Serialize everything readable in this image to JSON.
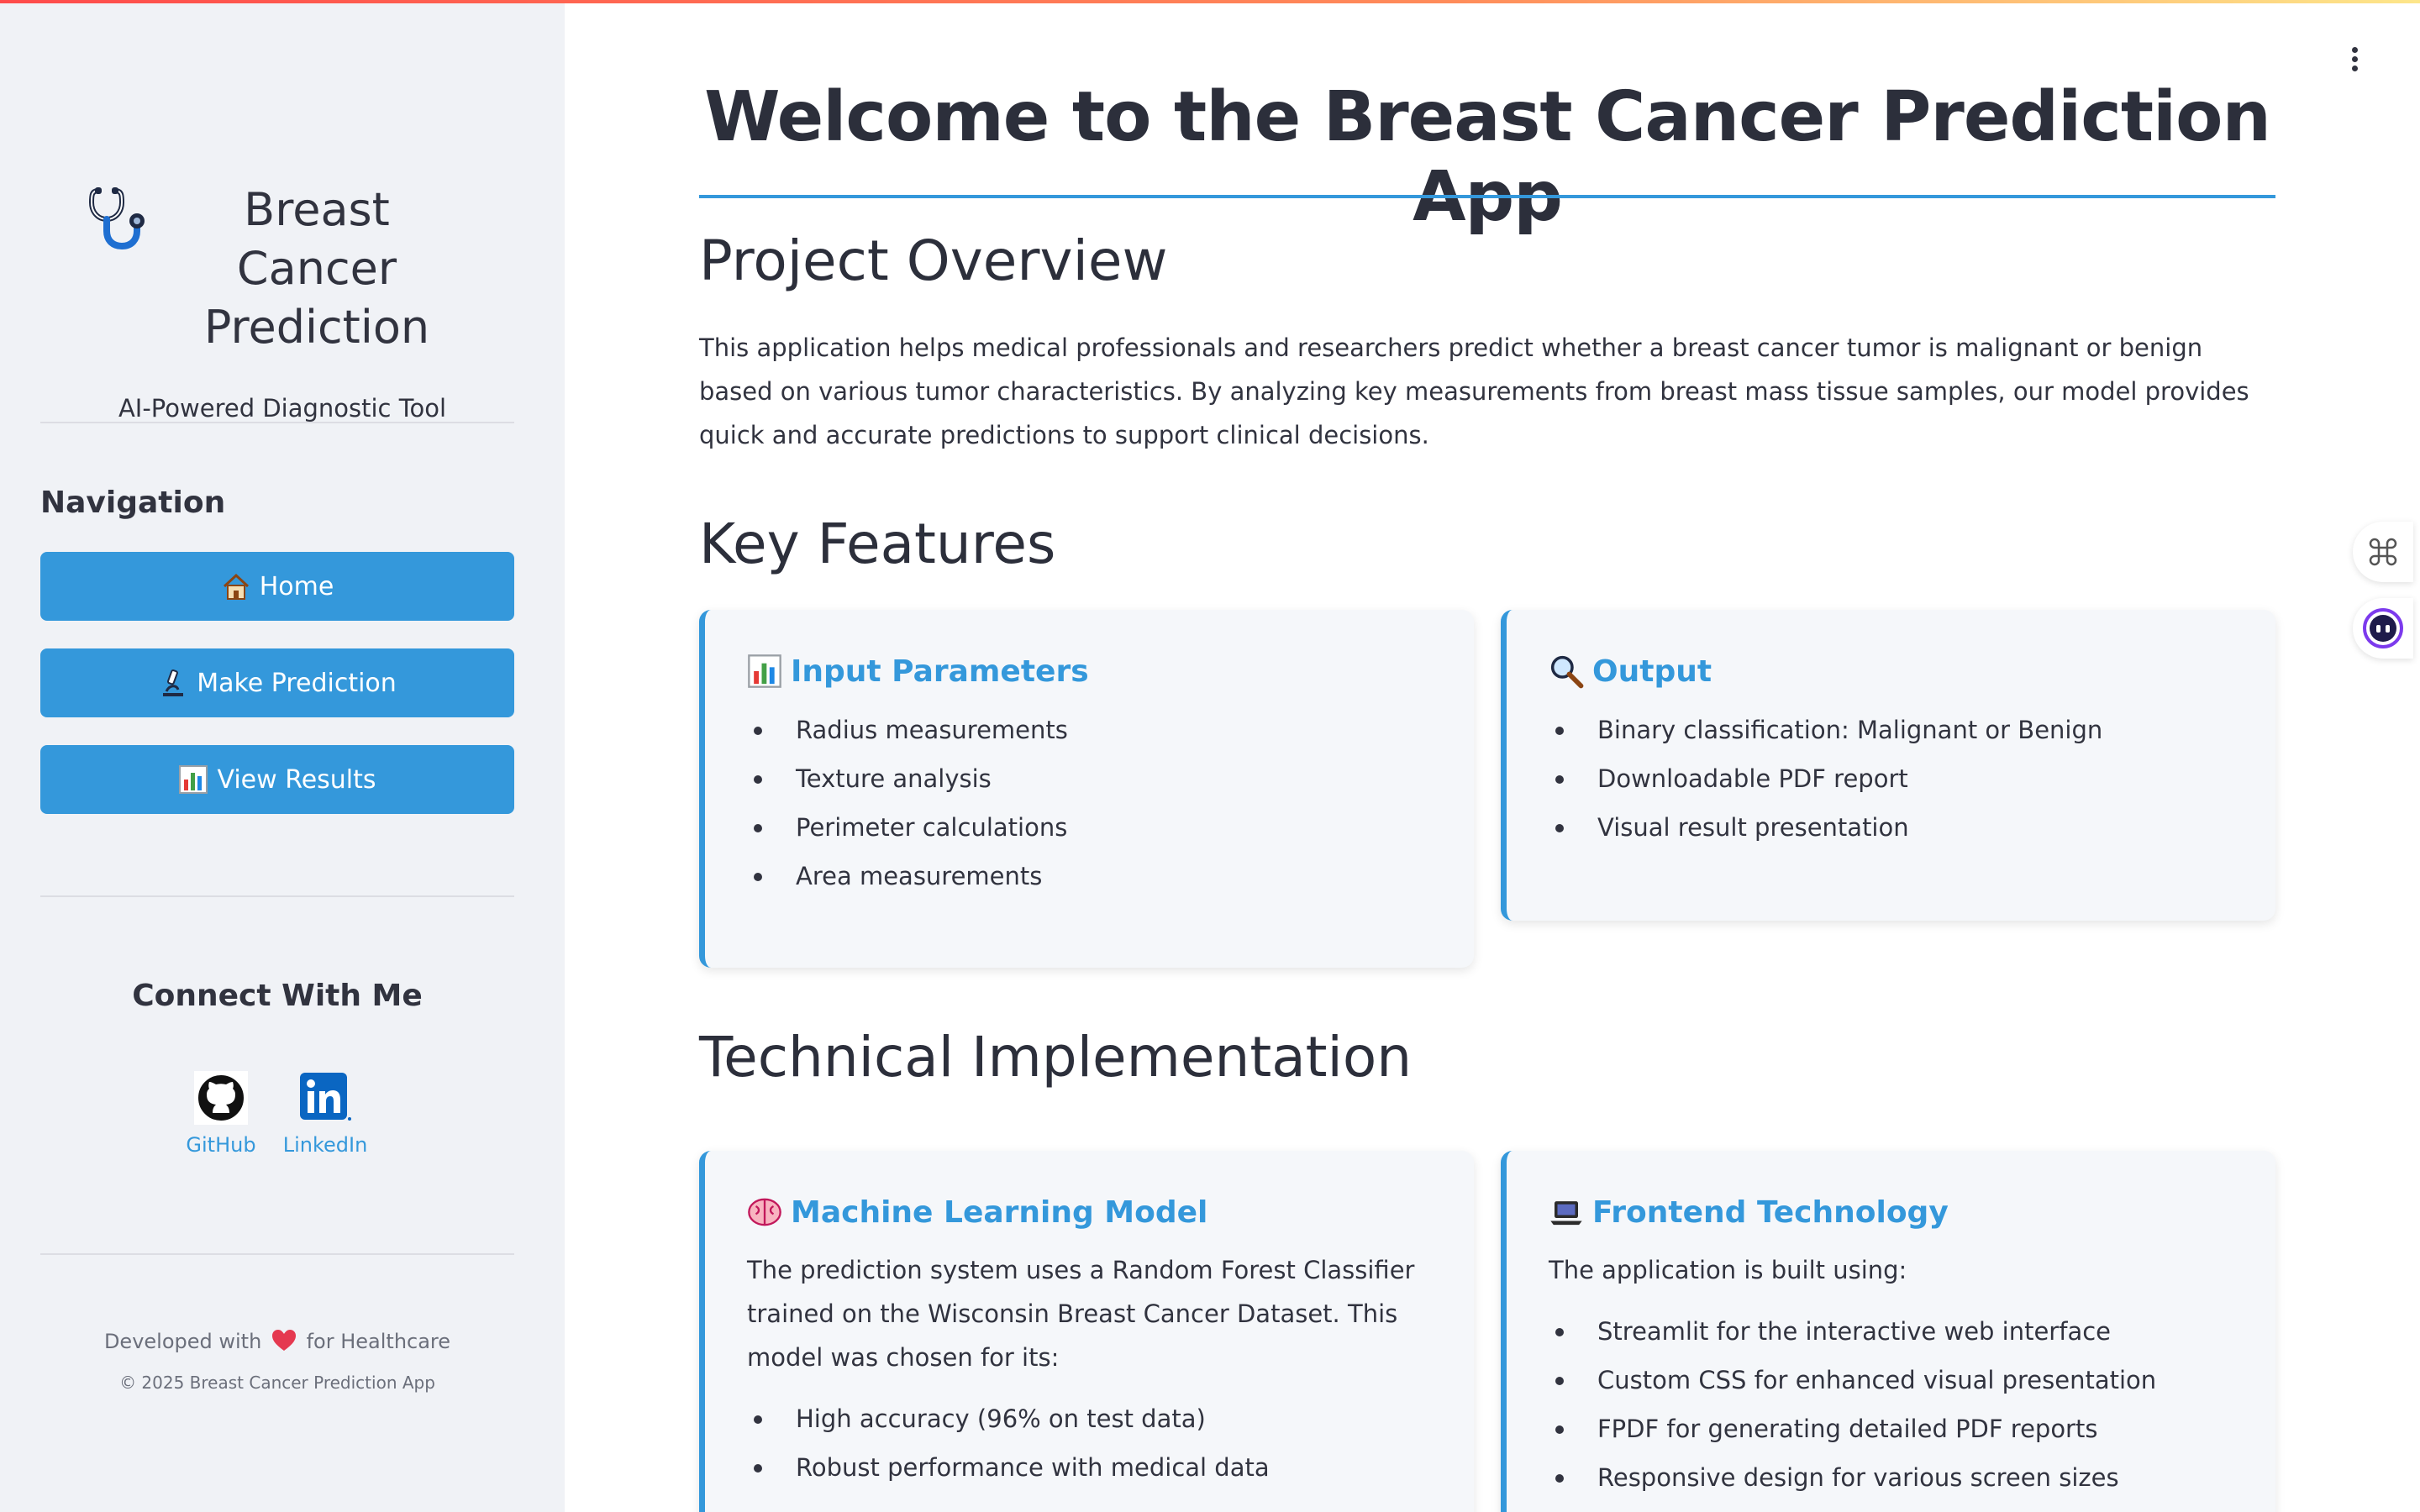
{
  "sidebar": {
    "brand_title": "Breast Cancer Prediction",
    "brand_icon": "stethoscope-icon",
    "subtitle": "AI-Powered Diagnostic Tool",
    "nav_heading": "Navigation",
    "nav": [
      {
        "label": "Home",
        "icon": "house-icon"
      },
      {
        "label": "Make Prediction",
        "icon": "microscope-icon"
      },
      {
        "label": "View Results",
        "icon": "bar-chart-icon"
      }
    ],
    "connect_title": "Connect With Me",
    "social": [
      {
        "label": "GitHub",
        "icon": "github-icon"
      },
      {
        "label": "LinkedIn",
        "icon": "linkedin-icon"
      }
    ],
    "footer_prefix": "Developed with",
    "footer_suffix": "for Healthcare",
    "copyright": "© 2025 Breast Cancer Prediction App"
  },
  "main": {
    "title": "Welcome to the Breast Cancer Prediction App",
    "overview_heading": "Project Overview",
    "overview_text": "This application helps medical professionals and researchers predict whether a breast cancer tumor is malignant or benign based on various tumor characteristics. By analyzing key measurements from breast mass tissue samples, our model provides quick and accurate predictions to support clinical decisions.",
    "features_heading": "Key Features",
    "features": [
      {
        "title": "Input Parameters",
        "icon": "bar-chart-icon",
        "items": [
          "Radius measurements",
          "Texture analysis",
          "Perimeter calculations",
          "Area measurements"
        ]
      },
      {
        "title": "Output",
        "icon": "magnifier-icon",
        "items": [
          "Binary classification: Malignant or Benign",
          "Downloadable PDF report",
          "Visual result presentation"
        ]
      }
    ],
    "tech_heading": "Technical Implementation",
    "tech": [
      {
        "title": "Machine Learning Model",
        "icon": "brain-icon",
        "text": "The prediction system uses a Random Forest Classifier trained on the Wisconsin Breast Cancer Dataset. This model was chosen for its:",
        "items": [
          "High accuracy (96% on test data)",
          "Robust performance with medical data"
        ]
      },
      {
        "title": "Frontend Technology",
        "icon": "laptop-icon",
        "text": "The application is built using:",
        "items": [
          "Streamlit for the interactive web interface",
          "Custom CSS for enhanced visual presentation",
          "FPDF for generating detailed PDF reports",
          "Responsive design for various screen sizes"
        ]
      }
    ]
  },
  "colors": {
    "accent": "#3498db",
    "sidebar_bg": "#f0f2f6",
    "card_bg": "#f5f7fa"
  }
}
